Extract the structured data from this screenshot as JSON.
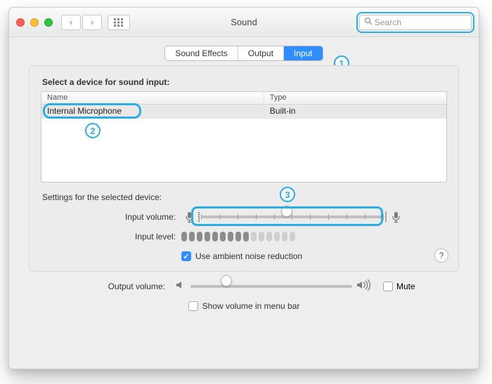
{
  "window": {
    "title": "Sound"
  },
  "search": {
    "placeholder": "Search"
  },
  "tabs": {
    "effects": "Sound Effects",
    "output": "Output",
    "input": "Input"
  },
  "pane": {
    "heading": "Select a device for sound input:",
    "col_name": "Name",
    "col_type": "Type",
    "row_name": "Internal Microphone",
    "row_type": "Built-in",
    "settings_label": "Settings for the selected device:",
    "input_volume_label": "Input volume:",
    "input_level_label": "Input level:",
    "ambient_label": "Use ambient noise reduction"
  },
  "footer": {
    "output_volume_label": "Output volume:",
    "mute_label": "Mute",
    "menubar_label": "Show volume in menu bar"
  },
  "annotations": {
    "a1": "1",
    "a2": "2",
    "a3": "3"
  },
  "help": "?"
}
